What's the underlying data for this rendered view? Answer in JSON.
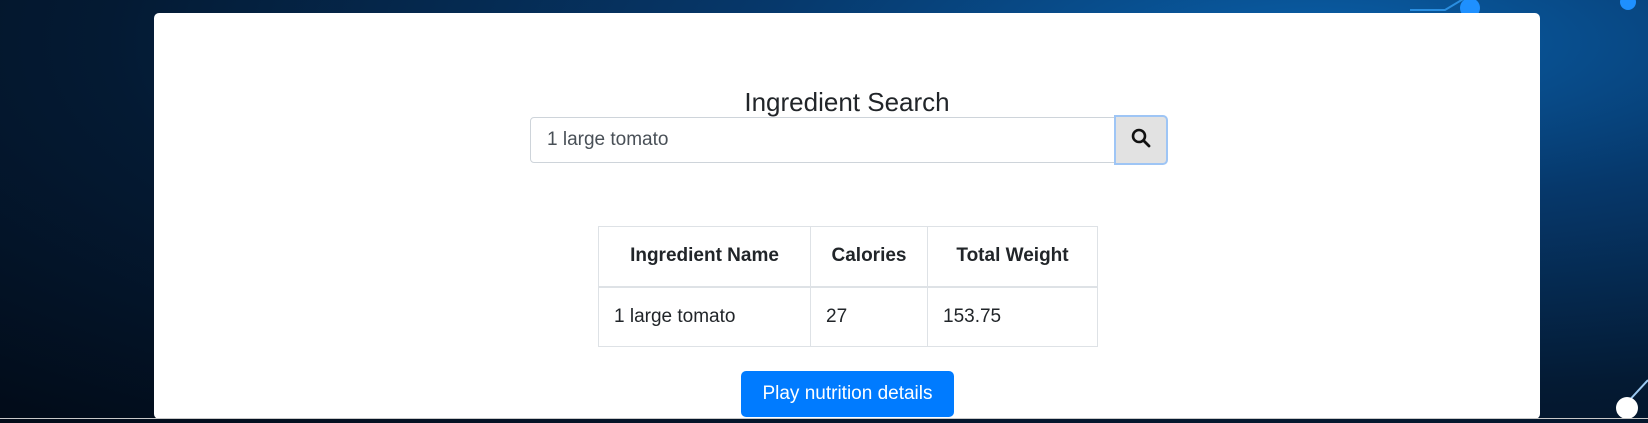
{
  "colors": {
    "accent": "#007bff",
    "card_bg": "#ffffff",
    "page_bg": "#041a33"
  },
  "search": {
    "title": "Ingredient Search",
    "value": "1 large tomato",
    "button_icon": "search-icon"
  },
  "table": {
    "headers": [
      "Ingredient Name",
      "Calories",
      "Total Weight"
    ],
    "rows": [
      [
        "1 large tomato",
        "27",
        "153.75"
      ]
    ]
  },
  "actions": {
    "play_label": "Play nutrition details"
  }
}
